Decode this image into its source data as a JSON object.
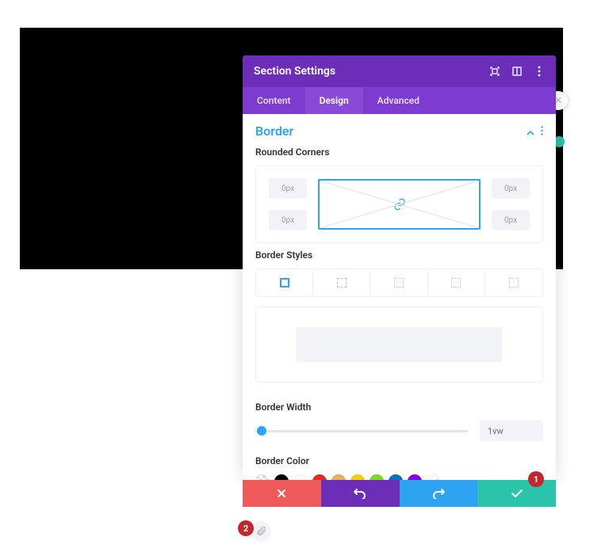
{
  "header": {
    "title": "Section Settings"
  },
  "tabs": {
    "content": "Content",
    "design": "Design",
    "advanced": "Advanced",
    "active": "design"
  },
  "section": {
    "title": "Border"
  },
  "rounded_corners": {
    "label": "Rounded Corners",
    "tl": "0px",
    "tr": "0px",
    "bl": "0px",
    "br": "0px"
  },
  "border_styles": {
    "label": "Border Styles"
  },
  "border_width": {
    "label": "Border Width",
    "value": "1vw"
  },
  "border_color": {
    "label": "Border Color",
    "swatches": [
      "#000000",
      "#ffffff",
      "#e02b20",
      "#edb059",
      "#fccf00",
      "#7cda24",
      "#0c71c3",
      "#8300e9"
    ]
  },
  "callouts": {
    "one": "1",
    "two": "2"
  }
}
